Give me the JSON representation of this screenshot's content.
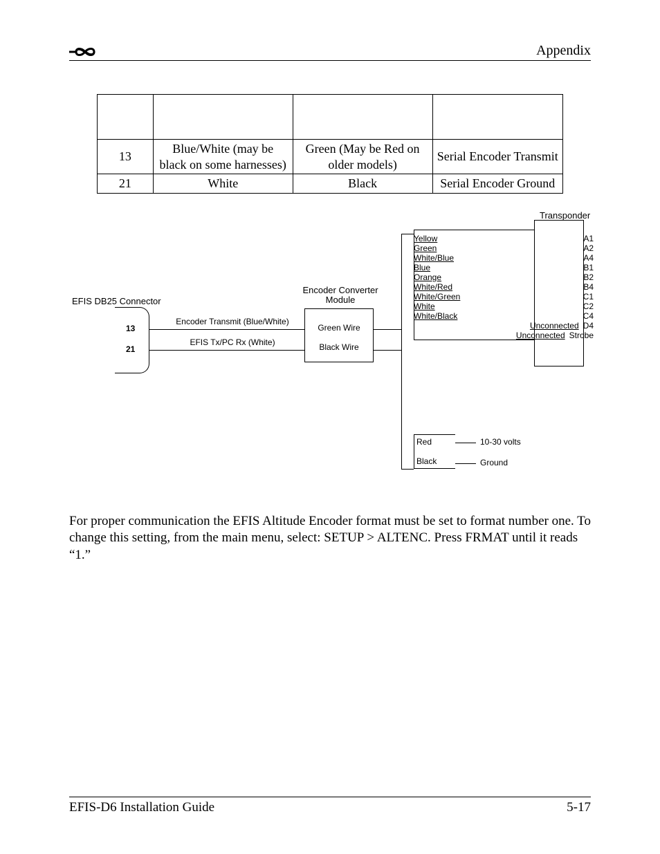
{
  "header": {
    "title": "Appendix"
  },
  "table": {
    "rows": [
      {
        "c0": "",
        "c1": "",
        "c2": "",
        "c3": ""
      },
      {
        "c0": "13",
        "c1": "Blue/White (may be black on some harnesses)",
        "c2": "Green (May be Red on older models)",
        "c3": "Serial Encoder Transmit"
      },
      {
        "c0": "21",
        "c1": "White",
        "c2": "Black",
        "c3": "Serial Encoder Ground"
      }
    ]
  },
  "diagram": {
    "connector_title": "EFIS DB25 Connector",
    "pin13": "13",
    "pin21": "21",
    "line13": "Encoder Transmit (Blue/White)",
    "line21": "EFIS Tx/PC Rx (White)",
    "module_title_1": "Encoder Converter",
    "module_title_2": "Module",
    "module_green": "Green Wire",
    "module_black": "Black Wire",
    "transponder_title": "Transponder",
    "xpond_rows": [
      {
        "left": "Yellow",
        "right": "A1",
        "u": true
      },
      {
        "left": "Green",
        "right": "A2",
        "u": true
      },
      {
        "left": "White/Blue",
        "right": "A4",
        "u": true
      },
      {
        "left": "Blue",
        "right": "B1",
        "u": true
      },
      {
        "left": "Orange",
        "right": "B2",
        "u": true
      },
      {
        "left": "White/Red",
        "right": "B4",
        "u": true
      },
      {
        "left": "White/Green",
        "right": "C1",
        "u": true
      },
      {
        "left": "White",
        "right": "C2",
        "u": true
      },
      {
        "left": "White/Black",
        "right": "C4",
        "u": true
      },
      {
        "left": "Unconnected",
        "right": "D4",
        "u": true,
        "align": "right"
      },
      {
        "left": "Unconnected",
        "right": "Strobe",
        "u": true,
        "align": "right"
      }
    ],
    "power_red": "Red",
    "power_black": "Black",
    "power_volts": "10-30 volts",
    "power_gnd": "Ground"
  },
  "body": {
    "p1": "For proper communication the EFIS Altitude Encoder format must be set to format number one. To change this setting, from the main menu, select: SETUP > ALTENC. Press FRMAT until it reads “1.”"
  },
  "footer": {
    "left": "EFIS-D6 Installation Guide",
    "right": "5-17"
  }
}
